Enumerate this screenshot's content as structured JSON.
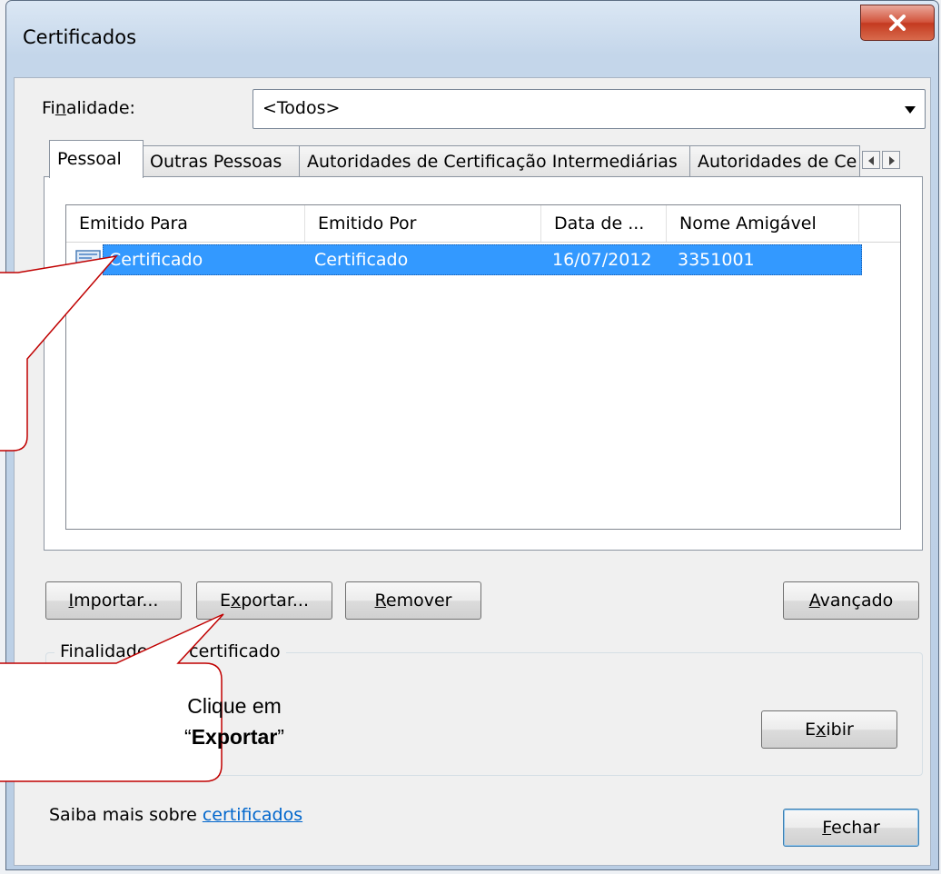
{
  "window": {
    "title": "Certificados"
  },
  "purpose": {
    "label_pre": "Fi",
    "label_accel": "n",
    "label_post": "alidade:",
    "selected": "<Todos>"
  },
  "tabs": [
    {
      "label": "Pessoal",
      "active": true
    },
    {
      "label": "Outras Pessoas",
      "active": false
    },
    {
      "label": "Autoridades de Certificação Intermediárias",
      "active": false
    },
    {
      "label": "Autoridades de Ce",
      "active": false
    }
  ],
  "list": {
    "columns": [
      "Emitido Para",
      "Emitido Por",
      "Data de ...",
      "Nome Amigável"
    ],
    "rows": [
      {
        "emitido_para": "Certificado",
        "emitido_por": "Certificado",
        "data": "16/07/2012",
        "nome": "3351001"
      }
    ]
  },
  "buttons": {
    "importar": {
      "accel": "I",
      "rest": "mportar..."
    },
    "exportar": {
      "pre": "E",
      "accel": "x",
      "rest": "portar..."
    },
    "remover": {
      "accel": "R",
      "rest": "emover"
    },
    "avancado": {
      "accel": "A",
      "rest": "vançado"
    },
    "exibir": {
      "pre": "E",
      "accel": "x",
      "rest": "ibir"
    },
    "fechar": {
      "accel": "F",
      "rest": "echar"
    }
  },
  "group": {
    "title": "Finalidades do certificado"
  },
  "footer": {
    "learn_prefix": "Saiba mais sobre ",
    "learn_link": "certificados"
  },
  "callout": {
    "line1": "Clique em",
    "quote_open": "“",
    "bold": "Exportar",
    "quote_close": "”"
  },
  "colors": {
    "selection": "#3399ff",
    "link": "#0066cc",
    "callout_border": "#c00000"
  }
}
